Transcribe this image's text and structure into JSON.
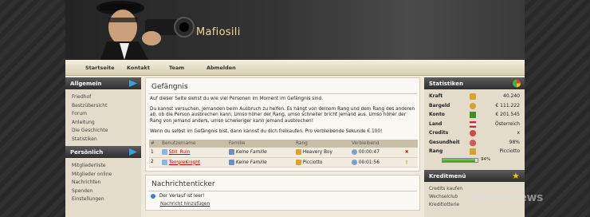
{
  "site": {
    "title": "Mafiosili"
  },
  "nav": [
    {
      "label": "Startseite"
    },
    {
      "label": "Kontakt"
    },
    {
      "label": "Team"
    },
    {
      "label": "Abmelden"
    }
  ],
  "sidebar_left": {
    "allgemein": {
      "title": "Allgemein",
      "items": [
        "Friedhof",
        "Bestzübersicht",
        "Forum",
        "Anleitung",
        "Die Geschichte",
        "Statistiken"
      ]
    },
    "persoenlich": {
      "title": "Persönlich",
      "items": [
        "Mitgliederliste",
        "Mitglieder online",
        "Nachrichten",
        "Spenden",
        "Einstellungen"
      ]
    }
  },
  "prison": {
    "title": "Gefängnis",
    "intro": "Auf dieser Seite siehst du wie viel Personen im Moment im Gefängnis sind.",
    "paragraph": "Du kannst versuchen, jemanden beim Ausbruch zu helfen. Es hängt von deinem Rang und dem Rang des anderen ab, ob die Person ausbrechen kann. Umso höher der Rang, umso schneller bricht jemand aus. Umso höher der Rang von jemand anders, umso schwieriger kann jemand ausbrechen!",
    "note": "Wenn du selbst im Gefängnis bist, dann kannst du dich freikaufen. Pro verbleibende Sekunde € 100!",
    "columns": [
      "#",
      "Benutzername",
      "Familie",
      "Rang",
      "Verbleibend"
    ],
    "rows": [
      {
        "num": "1",
        "user": "Still_Ruin",
        "family": "Keine Familie",
        "rank": "Heavery Boy",
        "remaining": "00:00:47"
      },
      {
        "num": "2",
        "user": "TempleKnight",
        "family": "Keine Familie",
        "rank": "Picciotto",
        "remaining": "00:01:56"
      }
    ]
  },
  "ticker": {
    "title": "Nachrichtenticker",
    "empty": "Der Verlauf ist leer!",
    "add_link": "Nachricht hinzufügen"
  },
  "stats": {
    "title": "Statistiken",
    "rows": [
      {
        "label": "Kraft",
        "value": "40.240",
        "icon": "power-icon",
        "color": "#d7a32a"
      },
      {
        "label": "Bargeld",
        "value": "€ 111.222",
        "icon": "cash-icon",
        "color": "#d4a22c"
      },
      {
        "label": "Konto",
        "value": "€ 201.545",
        "icon": "bank-icon",
        "color": "#3d8f2a"
      },
      {
        "label": "Land",
        "value": "Österreich",
        "icon": "flag-icon",
        "color": "#d42a2a"
      },
      {
        "label": "Credits",
        "value": "x",
        "icon": "credits-icon",
        "color": "#c94a4a"
      },
      {
        "label": "Gesundheit",
        "value": "98%",
        "icon": "health-icon",
        "color": "#d25a5a"
      },
      {
        "label": "Rang",
        "value": "Picciotto",
        "icon": "rank-icon",
        "color": "#d7a32a"
      }
    ],
    "rank_progress": {
      "percent": 94,
      "label": "94%"
    }
  },
  "kredit": {
    "title": "Kreditmenü",
    "items": [
      "Credits kaufen",
      "Wechselclub",
      "Kreditlotterie"
    ]
  },
  "watermark": {
    "text": "GalaxyNews"
  }
}
